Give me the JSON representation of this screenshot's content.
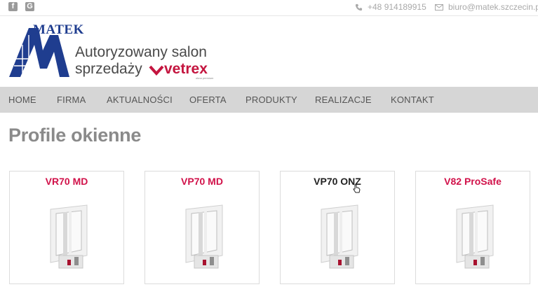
{
  "topbar": {
    "social": [
      {
        "name": "facebook",
        "glyph": "f"
      },
      {
        "name": "google",
        "glyph": "G"
      }
    ],
    "phone": "+48 914189915",
    "email": "biuro@matek.szczecin.pl"
  },
  "logo": {
    "brand": "MATEK",
    "tagline_line1": "Autoryzowany salon",
    "tagline_line2": "sprzedaży",
    "partner": "vetrex",
    "partner_sub": "okna premium"
  },
  "nav": {
    "items": [
      {
        "label": "HOME"
      },
      {
        "label": "FIRMA"
      },
      {
        "label": "AKTUALNOŚCI"
      },
      {
        "label": "OFERTA"
      },
      {
        "label": "PRODUKTY"
      },
      {
        "label": "REALIZACJE"
      },
      {
        "label": "KONTAKT"
      }
    ]
  },
  "main": {
    "title": "Profile okienne",
    "products": [
      {
        "name": "VR70 MD",
        "color": "#d1124a"
      },
      {
        "name": "VP70 MD",
        "color": "#d1124a"
      },
      {
        "name": "VP70 ONZ",
        "color": "#222222"
      },
      {
        "name": "V82 ProSafe",
        "color": "#d1124a"
      }
    ]
  },
  "colors": {
    "accent": "#d1124a",
    "brand_blue": "#1f3d8f",
    "nav_bg": "#d6d6d6"
  }
}
